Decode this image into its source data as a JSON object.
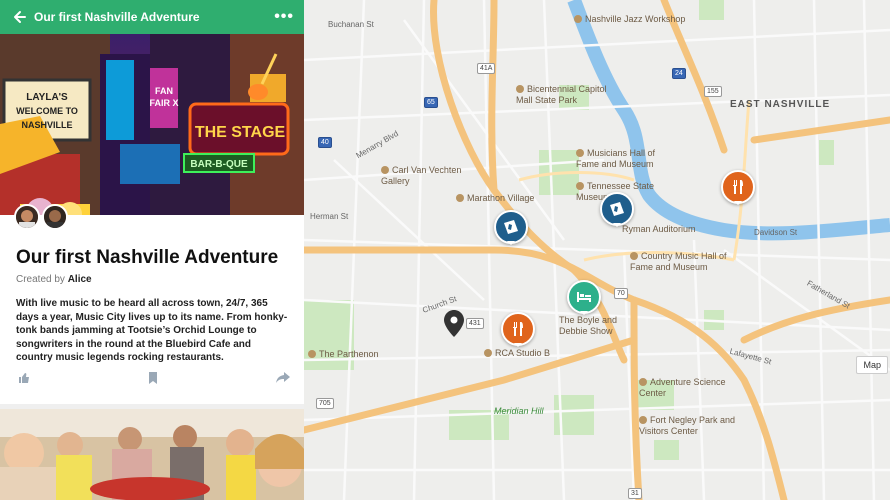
{
  "header": {
    "title": "Our first Nashville Adventure",
    "more": "•••"
  },
  "adventure": {
    "title": "Our first Nashville Adventure",
    "created_prefix": "Created by",
    "author": "Alice",
    "description": "With live music to be heard all across town, 24/7, 365 days a year, Music City lives up to its name. From honky-tonk bands jamming at Tootsie’s Orchid Lounge to songwriters in the round at the Bluebird Cafe and country music legends rocking restaurants."
  },
  "hero_signs": {
    "laylas": "LAYLA'S WELCOME TO NASHVILLE",
    "stage": "THE STAGE",
    "bbq": "BAR-B-QUE",
    "fan_fair": "FAN FAIR X"
  },
  "map": {
    "button": "Map",
    "districts": [
      "EAST NASHVILLE"
    ],
    "poi": [
      {
        "name": "Nashville Jazz Workshop"
      },
      {
        "name": "Bicentennial Capitol Mall State Park"
      },
      {
        "name": "Musicians Hall of Fame and Museum"
      },
      {
        "name": "Tennessee State Museum"
      },
      {
        "name": "Carl Van Vechten Gallery"
      },
      {
        "name": "Marathon Village"
      },
      {
        "name": "Ryman Auditorium"
      },
      {
        "name": "Country Music Hall of Fame and Museum"
      },
      {
        "name": "The Boyle and Debbie Show"
      },
      {
        "name": "RCA Studio B"
      },
      {
        "name": "The Parthenon"
      },
      {
        "name": "Adventure Science Center"
      },
      {
        "name": "Fort Negley Park and Visitors Center"
      }
    ],
    "parks": [
      "Meridian Hill"
    ],
    "roads": [
      "Buchanan St",
      "Herman St",
      "Church St",
      "Davidson St",
      "Lafayette St",
      "Fatherland St",
      "Menarry Blvd"
    ],
    "shields": [
      "41A",
      "65",
      "40",
      "24",
      "70",
      "431",
      "155",
      "705",
      "31"
    ]
  },
  "colors": {
    "topbar": "#2fae6f",
    "pin_blue": "#1f5e8c",
    "pin_orange": "#e0641c",
    "pin_teal": "#2db08b",
    "river": "#8fc4ec",
    "highway": "#f4c37d"
  }
}
